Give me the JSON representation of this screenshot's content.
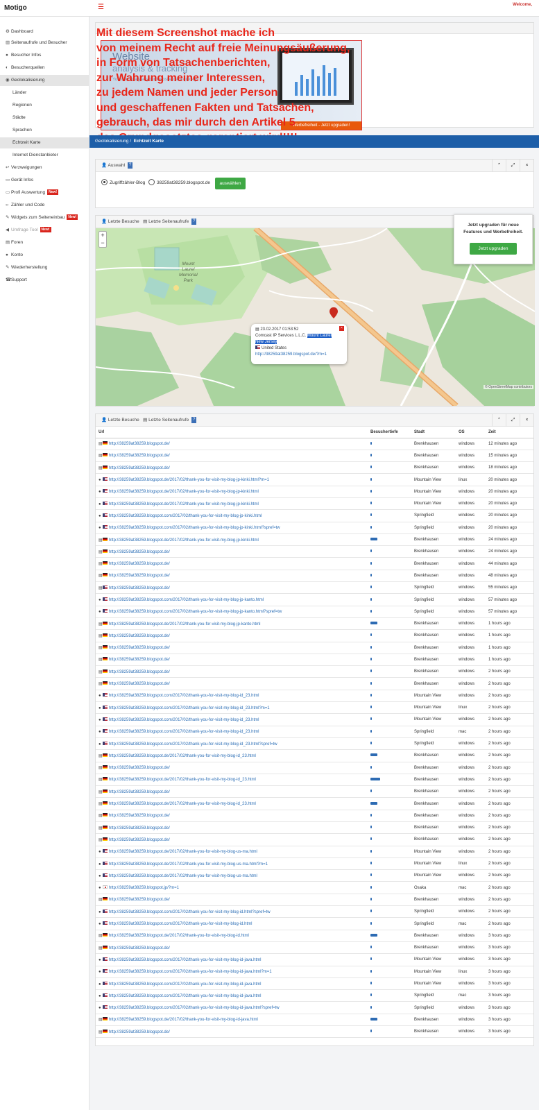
{
  "app": {
    "logo": "Motigo",
    "welcome": "Welcome,"
  },
  "sidebar": {
    "items": [
      {
        "label": "Dashboard",
        "icon": "sliders-icon"
      },
      {
        "label": "Seitenaufrufe und Besucher",
        "icon": "chart-icon"
      },
      {
        "label": "Besucher Infos",
        "icon": "user-icon"
      },
      {
        "label": "Besucherquellen",
        "icon": "source-icon"
      },
      {
        "label": "Geolokalisierung",
        "icon": "globe-icon"
      },
      {
        "label": "Länder"
      },
      {
        "label": "Regionen"
      },
      {
        "label": "Städte"
      },
      {
        "label": "Sprachen"
      },
      {
        "label": "Echtzeit Karte"
      },
      {
        "label": "Internet Dienstanbieter"
      },
      {
        "label": "Verzweigungen",
        "icon": "reply-icon"
      },
      {
        "label": "Gerät Infos",
        "icon": "monitor-icon"
      },
      {
        "label": "Profi Auswertung",
        "icon": "monitor-icon",
        "badge": "New!"
      },
      {
        "label": "Zähler und Code",
        "icon": "code-icon"
      },
      {
        "label": "Widgets zum Seiteneinbau",
        "icon": "wrench-icon",
        "badge": "New!"
      },
      {
        "label": "Umfrage Tool",
        "icon": "megaphone-icon",
        "badge": "New!"
      },
      {
        "label": "Foren",
        "icon": "comments-icon"
      },
      {
        "label": "Konto",
        "icon": "user-icon"
      },
      {
        "label": "Wiederherstellung",
        "icon": "wrench-icon"
      },
      {
        "label": "Support",
        "icon": "phone-icon"
      }
    ]
  },
  "ad": {
    "title1": "Website",
    "title2": "analysis & tracking",
    "subtitle": "You can analyse your website data quickly",
    "cta": "Werbefreiheit - Jetzt upgraden!"
  },
  "overlay_lines": [
    "Mit diesem Screenshot mache ich",
    "von meinem Recht auf freie Meinungsäußerung,",
    "in Form von Tatsachenberichten,",
    "zur Wahrung meiner Interessen,",
    "zu jedem Namen und jeder Person",
    "und geschaffenen Fakten und Tatsachen,",
    "gebrauch, das mir durch den Artikel 5",
    "des Grundgesetztes garantiert wird!!!!"
  ],
  "breadcrumb": {
    "parent": "Geolokalisierung",
    "current": "Echtzeit Karte"
  },
  "selection": {
    "title": "Auswahl",
    "option1": "Zugriffzähler-Blog",
    "option2": "38259at38259.blogspot.de",
    "button": "auswählen"
  },
  "map_panel": {
    "tab1": "Letzte Besuche",
    "tab2": "Letzte Seitenaufrufe",
    "zoom_in": "+",
    "zoom_out": "−",
    "label_park": [
      "Mount",
      "Laurel",
      "Memorial",
      "Park"
    ],
    "popup": {
      "time": "23.02.2017 01:53:52",
      "isp": "Comcast IP Services L.L.C.",
      "city_highlight": "Mount Laurel",
      "region_highlight": "New Jersey",
      "country": "United States",
      "url": "http://38259at38259.blogspot.de/?m=1"
    },
    "attribution": "© OpenStreetMap contributors"
  },
  "upgrade_box": {
    "text": "Jetzt upgraden für neue Features und Werbefreiheit.",
    "button": "Jetzt upgraden"
  },
  "table_panel": {
    "tab1": "Letzte Besuche",
    "tab2": "Letzte Seitenaufrufe",
    "columns": [
      "Url",
      "Besuchertiefe",
      "Stadt",
      "OS",
      "Zeit"
    ],
    "rows": [
      {
        "ic": "doc",
        "flag": "de",
        "url": "http://38259at38259.blogspot.de/",
        "depth": 1,
        "city": "Brenkhausen",
        "os": "windows",
        "time": "12 minutes ago"
      },
      {
        "ic": "doc",
        "flag": "de",
        "url": "http://38259at38259.blogspot.de/",
        "depth": 1,
        "city": "Brenkhausen",
        "os": "windows",
        "time": "15 minutes ago"
      },
      {
        "ic": "doc",
        "flag": "de",
        "url": "http://38259at38259.blogspot.de/",
        "depth": 1,
        "city": "Brenkhausen",
        "os": "windows",
        "time": "18 minutes ago"
      },
      {
        "ic": "user",
        "flag": "us",
        "url": "http://38259at38259.blogspot.de/2017/02/thank-you-for-visit-my-blog-jp-kinki.html?m=1",
        "depth": 1,
        "city": "Mountain View",
        "os": "linux",
        "time": "20 minutes ago"
      },
      {
        "ic": "user",
        "flag": "us",
        "url": "http://38259at38259.blogspot.de/2017/02/thank-you-for-visit-my-blog-jp-kinki.html",
        "depth": 1,
        "city": "Mountain View",
        "os": "windows",
        "time": "20 minutes ago"
      },
      {
        "ic": "user",
        "flag": "us",
        "url": "http://38259at38259.blogspot.de/2017/02/thank-you-for-visit-my-blog-jp-kinki.html",
        "depth": 1,
        "city": "Mountain View",
        "os": "windows",
        "time": "20 minutes ago"
      },
      {
        "ic": "user",
        "flag": "us",
        "url": "http://38259at38259.blogspot.com/2017/02/thank-you-for-visit-my-blog-jp-kinki.html",
        "depth": 1,
        "city": "Springfield",
        "os": "windows",
        "time": "20 minutes ago"
      },
      {
        "ic": "user",
        "flag": "us",
        "url": "http://38259at38259.blogspot.com/2017/02/thank-you-for-visit-my-blog-jp-kinki.html?spref=tw",
        "depth": 1,
        "city": "Springfield",
        "os": "windows",
        "time": "20 minutes ago"
      },
      {
        "ic": "doc",
        "flag": "de",
        "url": "http://38259at38259.blogspot.de/2017/02/thank-you-for-visit-my-blog-jp-kinki.html",
        "depth": 4,
        "city": "Brenkhausen",
        "os": "windows",
        "time": "24 minutes ago"
      },
      {
        "ic": "doc",
        "flag": "de",
        "url": "http://38259at38259.blogspot.de/",
        "depth": 1,
        "city": "Brenkhausen",
        "os": "windows",
        "time": "24 minutes ago"
      },
      {
        "ic": "doc",
        "flag": "de",
        "url": "http://38259at38259.blogspot.de/",
        "depth": 1,
        "city": "Brenkhausen",
        "os": "windows",
        "time": "44 minutes ago"
      },
      {
        "ic": "doc",
        "flag": "de",
        "url": "http://38259at38259.blogspot.de/",
        "depth": 1,
        "city": "Brenkhausen",
        "os": "windows",
        "time": "48 minutes ago"
      },
      {
        "ic": "doc",
        "flag": "us",
        "url": "http://38259at38259.blogspot.de/",
        "depth": 1,
        "city": "Springfield",
        "os": "windows",
        "time": "55 minutes ago"
      },
      {
        "ic": "user",
        "flag": "us",
        "url": "http://38259at38259.blogspot.com/2017/02/thank-you-for-visit-my-blog-jp-kanto.html",
        "depth": 1,
        "city": "Springfield",
        "os": "windows",
        "time": "57 minutes ago"
      },
      {
        "ic": "user",
        "flag": "us",
        "url": "http://38259at38259.blogspot.com/2017/02/thank-you-for-visit-my-blog-jp-kanto.html?spref=tw",
        "depth": 1,
        "city": "Springfield",
        "os": "windows",
        "time": "57 minutes ago"
      },
      {
        "ic": "doc",
        "flag": "de",
        "url": "http://38259at38259.blogspot.de/2017/02/thank-you-for-visit-my-blog-jp-kanto.html",
        "depth": 4,
        "city": "Brenkhausen",
        "os": "windows",
        "time": "1 hours ago"
      },
      {
        "ic": "doc",
        "flag": "de",
        "url": "http://38259at38259.blogspot.de/",
        "depth": 1,
        "city": "Brenkhausen",
        "os": "windows",
        "time": "1 hours ago"
      },
      {
        "ic": "doc",
        "flag": "de",
        "url": "http://38259at38259.blogspot.de/",
        "depth": 1,
        "city": "Brenkhausen",
        "os": "windows",
        "time": "1 hours ago"
      },
      {
        "ic": "doc",
        "flag": "de",
        "url": "http://38259at38259.blogspot.de/",
        "depth": 1,
        "city": "Brenkhausen",
        "os": "windows",
        "time": "1 hours ago"
      },
      {
        "ic": "doc",
        "flag": "de",
        "url": "http://38259at38259.blogspot.de/",
        "depth": 1,
        "city": "Brenkhausen",
        "os": "windows",
        "time": "2 hours ago"
      },
      {
        "ic": "doc",
        "flag": "de",
        "url": "http://38259at38259.blogspot.de/",
        "depth": 1,
        "city": "Brenkhausen",
        "os": "windows",
        "time": "2 hours ago"
      },
      {
        "ic": "user",
        "flag": "us",
        "url": "http://38259at38259.blogspot.com/2017/02/thank-you-for-visit-my-blog-id_23.html",
        "depth": 1,
        "city": "Mountain View",
        "os": "windows",
        "time": "2 hours ago"
      },
      {
        "ic": "user",
        "flag": "us",
        "url": "http://38259at38259.blogspot.com/2017/02/thank-you-for-visit-my-blog-id_23.html?m=1",
        "depth": 1,
        "city": "Mountain View",
        "os": "linux",
        "time": "2 hours ago"
      },
      {
        "ic": "user",
        "flag": "us",
        "url": "http://38259at38259.blogspot.com/2017/02/thank-you-for-visit-my-blog-id_23.html",
        "depth": 1,
        "city": "Mountain View",
        "os": "windows",
        "time": "2 hours ago"
      },
      {
        "ic": "user",
        "flag": "us",
        "url": "http://38259at38259.blogspot.com/2017/02/thank-you-for-visit-my-blog-id_23.html",
        "depth": 1,
        "city": "Springfield",
        "os": "mac",
        "time": "2 hours ago"
      },
      {
        "ic": "user",
        "flag": "us",
        "url": "http://38259at38259.blogspot.com/2017/02/thank-you-for-visit-my-blog-id_23.html?spref=tw",
        "depth": 1,
        "city": "Springfield",
        "os": "windows",
        "time": "2 hours ago"
      },
      {
        "ic": "doc",
        "flag": "de",
        "url": "http://38259at38259.blogspot.de/2017/02/thank-you-for-visit-my-blog-id_23.html",
        "depth": 4,
        "city": "Brenkhausen",
        "os": "windows",
        "time": "2 hours ago"
      },
      {
        "ic": "doc",
        "flag": "de",
        "url": "http://38259at38259.blogspot.de/",
        "depth": 1,
        "city": "Brenkhausen",
        "os": "windows",
        "time": "2 hours ago"
      },
      {
        "ic": "doc",
        "flag": "de",
        "url": "http://38259at38259.blogspot.de/2017/02/thank-you-for-visit-my-blog-id_23.html",
        "depth": 6,
        "city": "Brenkhausen",
        "os": "windows",
        "time": "2 hours ago"
      },
      {
        "ic": "doc",
        "flag": "de",
        "url": "http://38259at38259.blogspot.de/",
        "depth": 1,
        "city": "Brenkhausen",
        "os": "windows",
        "time": "2 hours ago"
      },
      {
        "ic": "doc",
        "flag": "de",
        "url": "http://38259at38259.blogspot.de/2017/02/thank-you-for-visit-my-blog-id_23.html",
        "depth": 4,
        "city": "Brenkhausen",
        "os": "windows",
        "time": "2 hours ago"
      },
      {
        "ic": "doc",
        "flag": "de",
        "url": "http://38259at38259.blogspot.de/",
        "depth": 1,
        "city": "Brenkhausen",
        "os": "windows",
        "time": "2 hours ago"
      },
      {
        "ic": "doc",
        "flag": "de",
        "url": "http://38259at38259.blogspot.de/",
        "depth": 1,
        "city": "Brenkhausen",
        "os": "windows",
        "time": "2 hours ago"
      },
      {
        "ic": "doc",
        "flag": "de",
        "url": "http://38259at38259.blogspot.de/",
        "depth": 1,
        "city": "Brenkhausen",
        "os": "windows",
        "time": "2 hours ago"
      },
      {
        "ic": "user",
        "flag": "us",
        "url": "http://38259at38259.blogspot.de/2017/02/thank-you-for-visit-my-blog-us-ma.html",
        "depth": 1,
        "city": "Mountain View",
        "os": "windows",
        "time": "2 hours ago"
      },
      {
        "ic": "user",
        "flag": "us",
        "url": "http://38259at38259.blogspot.de/2017/02/thank-you-for-visit-my-blog-us-ma.html?m=1",
        "depth": 1,
        "city": "Mountain View",
        "os": "linux",
        "time": "2 hours ago"
      },
      {
        "ic": "user",
        "flag": "us",
        "url": "http://38259at38259.blogspot.de/2017/02/thank-you-for-visit-my-blog-us-ma.html",
        "depth": 1,
        "city": "Mountain View",
        "os": "windows",
        "time": "2 hours ago"
      },
      {
        "ic": "user",
        "flag": "jp",
        "url": "http://38259at38259.blogspot.jp/?m=1",
        "depth": 1,
        "city": "Osaka",
        "os": "mac",
        "time": "2 hours ago"
      },
      {
        "ic": "doc",
        "flag": "de",
        "url": "http://38259at38259.blogspot.de/",
        "depth": 1,
        "city": "Brenkhausen",
        "os": "windows",
        "time": "2 hours ago"
      },
      {
        "ic": "user",
        "flag": "us",
        "url": "http://38259at38259.blogspot.com/2017/02/thank-you-for-visit-my-blog-id.html?spref=tw",
        "depth": 1,
        "city": "Springfield",
        "os": "windows",
        "time": "2 hours ago"
      },
      {
        "ic": "user",
        "flag": "us",
        "url": "http://38259at38259.blogspot.com/2017/02/thank-you-for-visit-my-blog-id.html",
        "depth": 1,
        "city": "Springfield",
        "os": "mac",
        "time": "2 hours ago"
      },
      {
        "ic": "doc",
        "flag": "de",
        "url": "http://38259at38259.blogspot.de/2017/02/thank-you-for-visit-my-blog-id.html",
        "depth": 4,
        "city": "Brenkhausen",
        "os": "windows",
        "time": "3 hours ago"
      },
      {
        "ic": "doc",
        "flag": "de",
        "url": "http://38259at38259.blogspot.de/",
        "depth": 1,
        "city": "Brenkhausen",
        "os": "windows",
        "time": "3 hours ago"
      },
      {
        "ic": "user",
        "flag": "us",
        "url": "http://38259at38259.blogspot.com/2017/02/thank-you-for-visit-my-blog-id-java.html",
        "depth": 1,
        "city": "Mountain View",
        "os": "windows",
        "time": "3 hours ago"
      },
      {
        "ic": "user",
        "flag": "us",
        "url": "http://38259at38259.blogspot.com/2017/02/thank-you-for-visit-my-blog-id-java.html?m=1",
        "depth": 1,
        "city": "Mountain View",
        "os": "linux",
        "time": "3 hours ago"
      },
      {
        "ic": "user",
        "flag": "us",
        "url": "http://38259at38259.blogspot.com/2017/02/thank-you-for-visit-my-blog-id-java.html",
        "depth": 1,
        "city": "Mountain View",
        "os": "windows",
        "time": "3 hours ago"
      },
      {
        "ic": "user",
        "flag": "us",
        "url": "http://38259at38259.blogspot.com/2017/02/thank-you-for-visit-my-blog-id-java.html",
        "depth": 1,
        "city": "Springfield",
        "os": "mac",
        "time": "3 hours ago"
      },
      {
        "ic": "user",
        "flag": "us",
        "url": "http://38259at38259.blogspot.com/2017/02/thank-you-for-visit-my-blog-id-java.html?spref=tw",
        "depth": 1,
        "city": "Springfield",
        "os": "windows",
        "time": "3 hours ago"
      },
      {
        "ic": "doc",
        "flag": "de",
        "url": "http://38259at38259.blogspot.de/2017/02/thank-you-for-visit-my-blog-id-java.html",
        "depth": 4,
        "city": "Brenkhausen",
        "os": "windows",
        "time": "3 hours ago"
      },
      {
        "ic": "doc",
        "flag": "de",
        "url": "http://38259at38259.blogspot.de/",
        "depth": 1,
        "city": "Brenkhausen",
        "os": "windows",
        "time": "3 hours ago"
      }
    ]
  },
  "colors": {
    "primary_blue": "#1d5ea8",
    "link": "#2a6db5",
    "green": "#3ea844",
    "badge_red": "#d9251d",
    "overlay_red": "#e8261a"
  }
}
